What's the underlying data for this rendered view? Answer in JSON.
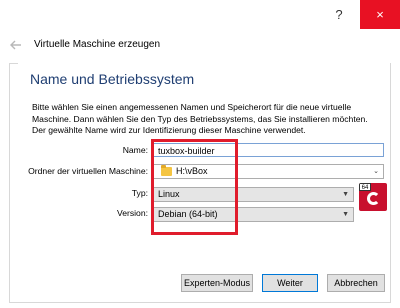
{
  "window": {
    "help_label": "?",
    "close_label": "×"
  },
  "header": {
    "title": "Virtuelle Maschine erzeugen"
  },
  "page": {
    "title": "Name und Betriebssystem",
    "description": "Bitte wählen Sie einen angemessenen Namen und Speicherort für die neue virtuelle Maschine. Dann wählen Sie den Typ des Betriebssystems, das Sie installieren möchten. Der gewählte Name wird zur Identifizierung dieser Maschine verwendet."
  },
  "form": {
    "name_label": "Name:",
    "name_value": "tuxbox-builder",
    "folder_label": "Ordner der virtuellen Maschine:",
    "folder_value": "H:\\vBox",
    "type_label": "Typ:",
    "type_value": "Linux",
    "version_label": "Version:",
    "version_value": "Debian (64-bit)",
    "os_badge": "64"
  },
  "buttons": {
    "expert": "Experten-Modus",
    "next": "Weiter",
    "cancel": "Abbrechen"
  },
  "colors": {
    "highlight": "#e01c2c",
    "title": "#1f3e72",
    "close": "#e81123"
  }
}
